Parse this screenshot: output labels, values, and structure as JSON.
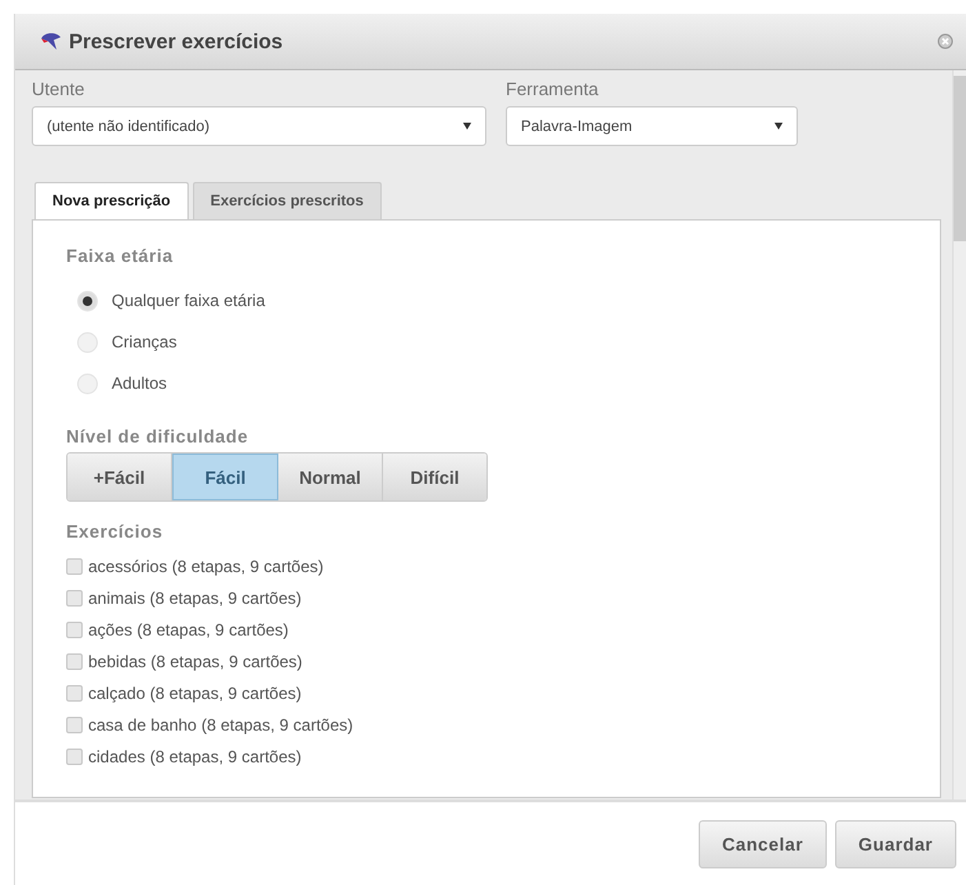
{
  "window": {
    "title": "Prescrever exercícios"
  },
  "fields": [
    {
      "label": "Utente",
      "value": "(utente não identificado)"
    },
    {
      "label": "Ferramenta",
      "value": "Palavra-Imagem"
    }
  ],
  "tabs": [
    {
      "label": "Nova prescrição",
      "selected": true
    },
    {
      "label": "Exercícios prescritos",
      "selected": false
    }
  ],
  "age_group": {
    "title": "Faixa etária",
    "options": [
      {
        "label": "Qualquer faixa etária",
        "selected": true
      },
      {
        "label": "Crianças",
        "selected": false
      },
      {
        "label": "Adultos",
        "selected": false
      }
    ]
  },
  "difficulty": {
    "title": "Nível de dificuldade",
    "options": [
      {
        "label": "+Fácil",
        "selected": false
      },
      {
        "label": "Fácil",
        "selected": true
      },
      {
        "label": "Normal",
        "selected": false
      },
      {
        "label": "Difícil",
        "selected": false
      }
    ]
  },
  "exercises": {
    "title": "Exercícios",
    "items": [
      {
        "label": "acessórios (8 etapas, 9 cartões)",
        "checked": false
      },
      {
        "label": "animais (8 etapas, 9 cartões)",
        "checked": false
      },
      {
        "label": "ações (8 etapas, 9 cartões)",
        "checked": false
      },
      {
        "label": "bebidas (8 etapas, 9 cartões)",
        "checked": false
      },
      {
        "label": "calçado (8 etapas, 9 cartões)",
        "checked": false
      },
      {
        "label": "casa de banho (8 etapas, 9 cartões)",
        "checked": false
      },
      {
        "label": "cidades (8 etapas, 9 cartões)",
        "checked": false
      }
    ]
  },
  "buttons": [
    "Cancelar",
    "Guardar"
  ]
}
